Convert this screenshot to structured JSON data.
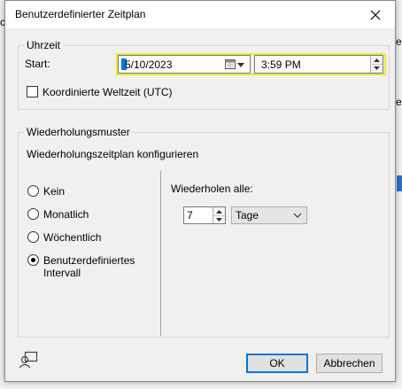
{
  "background": {
    "fragments": [
      "ch",
      "erc",
      "erc"
    ],
    "accent_color": "#2a6fc9"
  },
  "dialog": {
    "title": "Benutzerdefinierter Zeitplan",
    "close_icon": "close-icon"
  },
  "uhrzeit": {
    "legend": "Uhrzeit",
    "start_label": "Start:",
    "date_value": "5/10/2023",
    "time_value": "3:59 PM",
    "utc_label": "Koordinierte Weltzeit (UTC)",
    "utc_checked": false,
    "highlight_color": "#eaea2a"
  },
  "pattern": {
    "legend": "Wiederholungsmuster",
    "configure_label": "Wiederholungszeitplan konfigurieren",
    "options": [
      {
        "label": "Kein",
        "checked": false
      },
      {
        "label": "Monatlich",
        "checked": false
      },
      {
        "label": "Wöchentlich",
        "checked": false
      },
      {
        "label": "Benutzerdefiniertes",
        "label2": "Intervall",
        "checked": true
      }
    ],
    "repeat_label": "Wiederholen alle:",
    "repeat_value": "7",
    "unit_value": "Tage"
  },
  "footer": {
    "ok_label": "OK",
    "cancel_label": "Abbrechen",
    "help_icon": "user-help-icon"
  }
}
